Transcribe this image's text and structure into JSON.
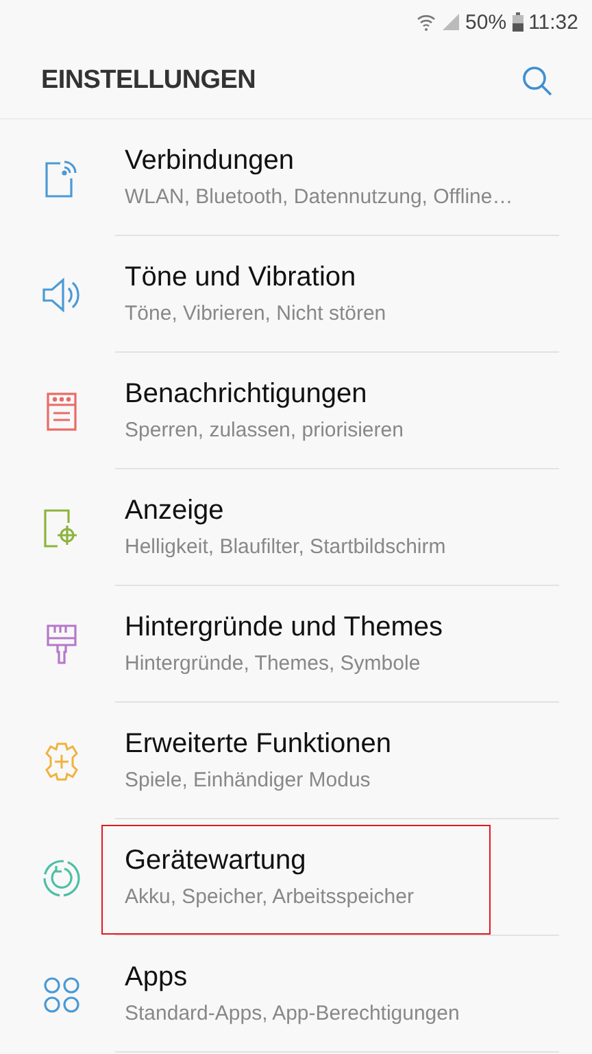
{
  "status_bar": {
    "battery": "50%",
    "time": "11:32"
  },
  "header": {
    "title": "EINSTELLUNGEN"
  },
  "items": [
    {
      "kind": "connections",
      "color": "#4a9ad6",
      "title": "Verbindungen",
      "subtitle": "WLAN, Bluetooth, Datennutzung, Offline…",
      "highlighted": false
    },
    {
      "kind": "sound",
      "color": "#4a9ad6",
      "title": "Töne und Vibration",
      "subtitle": "Töne, Vibrieren, Nicht stören",
      "highlighted": false
    },
    {
      "kind": "notifications",
      "color": "#ea6b66",
      "title": "Benachrichtigungen",
      "subtitle": "Sperren, zulassen, priorisieren",
      "highlighted": false
    },
    {
      "kind": "display",
      "color": "#8db43d",
      "title": "Anzeige",
      "subtitle": "Helligkeit, Blaufilter, Startbildschirm",
      "highlighted": false
    },
    {
      "kind": "themes",
      "color": "#b678c9",
      "title": "Hintergründe und Themes",
      "subtitle": "Hintergründe, Themes, Symbole",
      "highlighted": false
    },
    {
      "kind": "advanced",
      "color": "#f0b23c",
      "title": "Erweiterte Funktionen",
      "subtitle": "Spiele, Einhändiger Modus",
      "highlighted": false
    },
    {
      "kind": "maintenance",
      "color": "#4dbfa6",
      "title": "Gerätewartung",
      "subtitle": "Akku, Speicher, Arbeitsspeicher",
      "highlighted": true
    },
    {
      "kind": "apps",
      "color": "#4a9ad6",
      "title": "Apps",
      "subtitle": "Standard-Apps, App-Berechtigungen",
      "highlighted": false
    }
  ]
}
